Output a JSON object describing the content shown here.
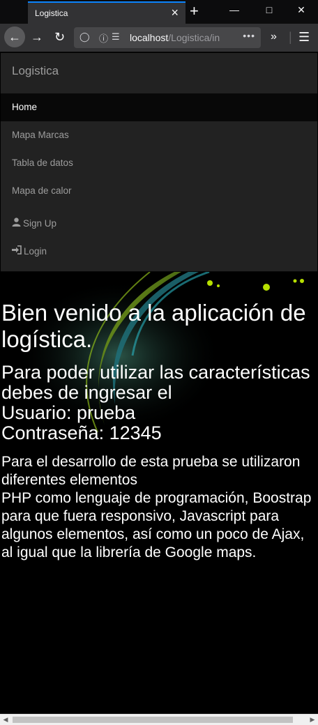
{
  "browser": {
    "tab_title": "Logistica",
    "url_host": "localhost",
    "url_path": "/Logistica/in",
    "close_glyph": "×",
    "new_tab_glyph": "+"
  },
  "site": {
    "brand": "Logistica",
    "nav": [
      {
        "label": "Home",
        "active": true
      },
      {
        "label": "Mapa Marcas"
      },
      {
        "label": "Tabla de datos"
      },
      {
        "label": "Mapa de calor"
      },
      {
        "label": "Sign Up",
        "icon": "user-icon"
      },
      {
        "label": "Login",
        "icon": "login-icon"
      }
    ]
  },
  "main": {
    "heading": "Bien venido a la aplicación de logística.",
    "sub_lines": [
      "Para poder utilizar las características debes de ingresar el",
      "Usuario: prueba",
      "Contraseña: 12345"
    ],
    "para_lines": [
      "Para el desarrollo de esta prueba se utilizaron diferentes elementos",
      "PHP como lenguaje de programación, Boostrap para que fuera responsivo, Javascript para algunos elementos, así como un poco de Ajax, al igual que la librería de Google maps."
    ]
  },
  "colors": {
    "accent": "#0a84ff",
    "navbar_bg": "#222222",
    "active_bg": "#080808"
  }
}
